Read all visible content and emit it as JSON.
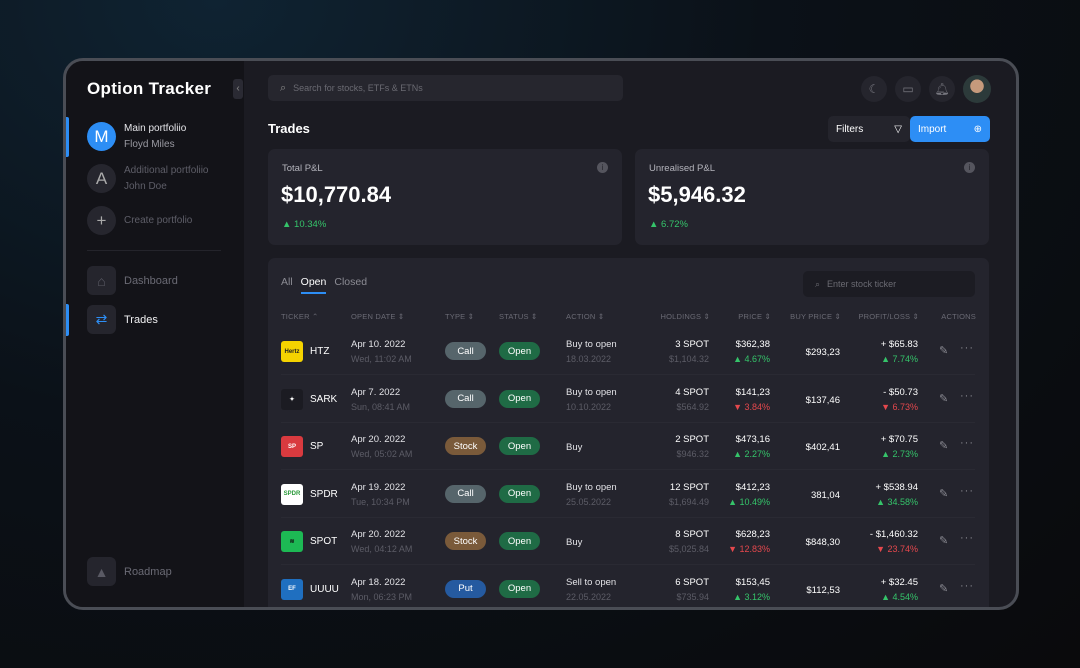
{
  "app": {
    "title": "Option Tracker"
  },
  "sidebar": {
    "portfolios": [
      {
        "initial": "M",
        "name": "Main portfoliio",
        "owner": "Floyd Miles",
        "active": true
      },
      {
        "initial": "A",
        "name": "Additional portfoliio",
        "owner": "John Doe",
        "active": false
      }
    ],
    "create": {
      "icon": "plus-icon",
      "label": "Create portfolio"
    },
    "nav": [
      {
        "label": "Dashboard",
        "icon": "home-icon"
      },
      {
        "label": "Trades",
        "icon": "trades-arrows-icon",
        "active": true
      }
    ],
    "roadmap": {
      "label": "Roadmap",
      "icon": "roadmap-icon"
    }
  },
  "header": {
    "search_placeholder": "Search for stocks, ETFs & ETNs",
    "icons": [
      "moon-icon",
      "calendar-icon",
      "notification-icon"
    ]
  },
  "page": {
    "title": "Trades",
    "filters_label": "Filters",
    "import_label": "Import"
  },
  "kpis": [
    {
      "label": "Total P&L",
      "value": "$10,770.84",
      "change": "▲ 10.34%"
    },
    {
      "label": "Unrealised P&L",
      "value": "$5,946.32",
      "change": "▲ 6.72%"
    }
  ],
  "table": {
    "tabs": [
      "All",
      "Open",
      "Closed"
    ],
    "active_tab": "Open",
    "search_placeholder": "Enter stock ticker",
    "columns": [
      "TICKER ⌃",
      "OPEN DATE ⇕",
      "TYPE ⇕",
      "STATUS ⇕",
      "ACTION ⇕",
      "HOLDINGS ⇕",
      "PRICE ⇕",
      "BUY PRICE ⇕",
      "PROFIT/LOSS ⇕",
      "ACTIONS"
    ],
    "rows": [
      {
        "logo": "Hertz",
        "logo_bg": "#f5d300",
        "logo_fg": "#222",
        "ticker": "HTZ",
        "date": "Apr 10. 2022",
        "time": "Wed, 11:02 AM",
        "type": "Call",
        "status": "Open",
        "action": "Buy to open",
        "action_date": "18.03.2022",
        "holdings": "3 SPOT",
        "holdings_value": "$1,104.32",
        "price": "$362,38",
        "price_change": "▲ 4.67%",
        "price_dir": "up",
        "buy_price": "$293,23",
        "pl": "+ $65.83",
        "pl_change": "▲ 7.74%",
        "pl_dir": "up"
      },
      {
        "logo": "✦",
        "logo_bg": "#1b1b22",
        "logo_fg": "#fff",
        "ticker": "SARK",
        "date": "Apr 7. 2022",
        "time": "Sun, 08:41 AM",
        "type": "Call",
        "status": "Open",
        "action": "Buy to open",
        "action_date": "10.10.2022",
        "holdings": "4 SPOT",
        "holdings_value": "$564.92",
        "price": "$141,23",
        "price_change": "▼ 3.84%",
        "price_dir": "dn",
        "buy_price": "$137,46",
        "pl": "- $50.73",
        "pl_change": "▼ 6.73%",
        "pl_dir": "dn"
      },
      {
        "logo": "SP",
        "logo_bg": "#d93a3f",
        "logo_fg": "#fff",
        "ticker": "SP",
        "date": "Apr 20. 2022",
        "time": "Wed, 05:02 AM",
        "type": "Stock",
        "status": "Open",
        "action": "Buy",
        "action_date": "",
        "holdings": "2 SPOT",
        "holdings_value": "$946.32",
        "price": "$473,16",
        "price_change": "▲ 2.27%",
        "price_dir": "up",
        "buy_price": "$402,41",
        "pl": "+ $70.75",
        "pl_change": "▲ 2.73%",
        "pl_dir": "up"
      },
      {
        "logo": "SPDR",
        "logo_bg": "#ffffff",
        "logo_fg": "#2a9a3a",
        "ticker": "SPDR",
        "date": "Apr 19. 2022",
        "time": "Tue, 10:34 PM",
        "type": "Call",
        "status": "Open",
        "action": "Buy to open",
        "action_date": "25.05.2022",
        "holdings": "12 SPOT",
        "holdings_value": "$1,694.49",
        "price": "$412,23",
        "price_change": "▲ 10.49%",
        "price_dir": "up",
        "buy_price": "381,04",
        "pl": "+ $538.94",
        "pl_change": "▲ 34.58%",
        "pl_dir": "up"
      },
      {
        "logo": "≋",
        "logo_bg": "#1db954",
        "logo_fg": "#111",
        "ticker": "SPOT",
        "date": "Apr 20. 2022",
        "time": "Wed, 04:12 AM",
        "type": "Stock",
        "status": "Open",
        "action": "Buy",
        "action_date": "",
        "holdings": "8 SPOT",
        "holdings_value": "$5,025.84",
        "price": "$628,23",
        "price_change": "▼ 12.83%",
        "price_dir": "dn",
        "buy_price": "$848,30",
        "pl": "- $1,460.32",
        "pl_change": "▼ 23.74%",
        "pl_dir": "dn"
      },
      {
        "logo": "EF",
        "logo_bg": "#1f6fc0",
        "logo_fg": "#fff",
        "ticker": "UUUU",
        "date": "Apr 18. 2022",
        "time": "Mon, 06:23 PM",
        "type": "Put",
        "status": "Open",
        "action": "Sell to open",
        "action_date": "22.05.2022",
        "holdings": "6 SPOT",
        "holdings_value": "$735.94",
        "price": "$153,45",
        "price_change": "▲ 3.12%",
        "price_dir": "up",
        "buy_price": "$112,53",
        "pl": "+ $32.45",
        "pl_change": "▲ 4.54%",
        "pl_dir": "up"
      }
    ]
  },
  "colors": {
    "accent": "#2d8ef5",
    "up": "#35c46a",
    "down": "#e5484d",
    "call": "#56656b",
    "stock": "#7a5a3a",
    "put": "#255aa0",
    "open": "#1f6b45"
  }
}
